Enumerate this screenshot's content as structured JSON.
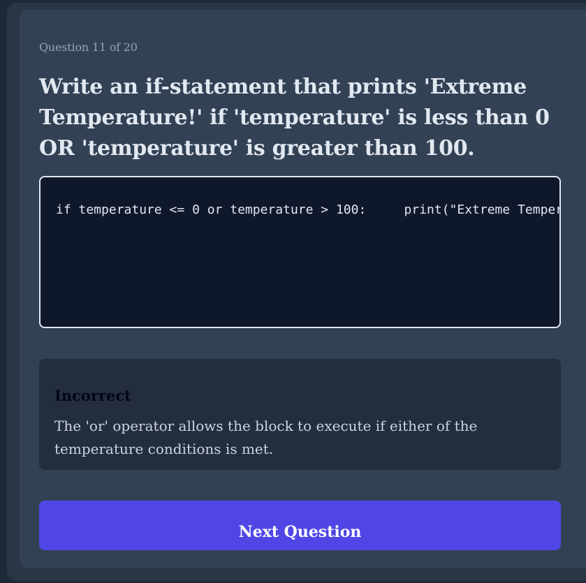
{
  "quiz": {
    "progress": "Question 11 of 20",
    "question": "Write an if-statement that prints 'Extreme Temperature!' if 'temperature' is less than 0 OR 'temperature' is greater than 100.",
    "code_answer": "if temperature <= 0 or temperature > 100:     print(\"Extreme Temperature!\")"
  },
  "feedback": {
    "status": "Incorrect",
    "explanation": "The 'or' operator allows the block to execute if either of the temperature conditions is met."
  },
  "actions": {
    "next_label": "Next Question"
  },
  "colors": {
    "page_background": "#1e2838",
    "card_background": "#334155",
    "code_background": "#0f172a",
    "feedback_background": "#242d3d",
    "accent": "#4f46e5"
  }
}
